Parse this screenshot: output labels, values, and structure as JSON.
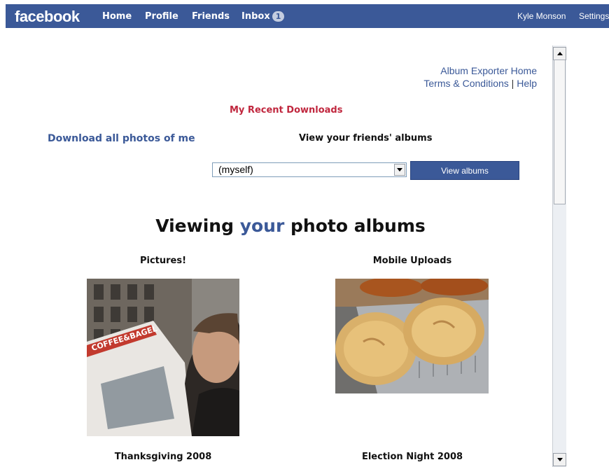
{
  "topbar": {
    "logo": "facebook",
    "nav": [
      "Home",
      "Profile",
      "Friends"
    ],
    "inbox_label": "Inbox",
    "inbox_count": "1",
    "user_name": "Kyle Monson",
    "settings": "Settings"
  },
  "links": {
    "exporter_home": "Album Exporter Home",
    "terms": "Terms & Conditions",
    "separator": "|",
    "help": "Help",
    "recent_downloads": "My Recent Downloads",
    "download_all": "Download all photos of me"
  },
  "friends": {
    "heading": "View your friends' albums",
    "selected": "(myself)",
    "button": "View albums"
  },
  "page_heading": {
    "prefix": "Viewing ",
    "emphasis": "your",
    "suffix": " photo albums"
  },
  "albums": [
    {
      "title": "Pictures!"
    },
    {
      "title": "Mobile Uploads"
    },
    {
      "title": "Thanksgiving 2008"
    },
    {
      "title": "Election Night 2008"
    }
  ],
  "colors": {
    "brand": "#3b5998",
    "accent_red": "#c0273e"
  }
}
